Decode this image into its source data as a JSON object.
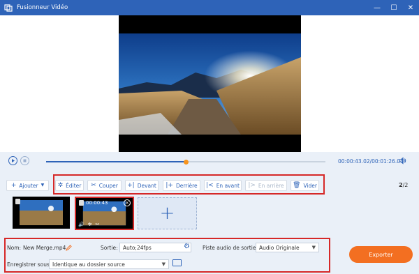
{
  "window": {
    "title": "Fusionneur Vidéo"
  },
  "playback": {
    "time": "00:00:43.02/00:01:26.04",
    "progress": 0.5
  },
  "toolbar": {
    "add_label": "Ajouter",
    "edit_label": "Éditer",
    "cut_label": "Couper",
    "front_label": "Devant",
    "behind_label": "Derrière",
    "forward_label": "En avant",
    "backward_label": "En arrière",
    "clear_label": "Vider",
    "page_current": "2",
    "page_total": "2"
  },
  "clips": [
    {
      "duration": ""
    },
    {
      "duration": "00:00:43"
    }
  ],
  "output": {
    "name_label": "Nom:",
    "name_value": "New Merge.mp4",
    "output_label": "Sortie:",
    "output_value": "Auto;24fps",
    "audio_label": "Piste audio de sortie :",
    "audio_value": "Audio Originale",
    "save_label": "Enregistrer sous:",
    "save_value": "Identique au dossier source",
    "export_label": "Exporter"
  },
  "colors": {
    "brand": "#2e63b8",
    "accent": "#f36f21",
    "highlight": "#d62828"
  }
}
